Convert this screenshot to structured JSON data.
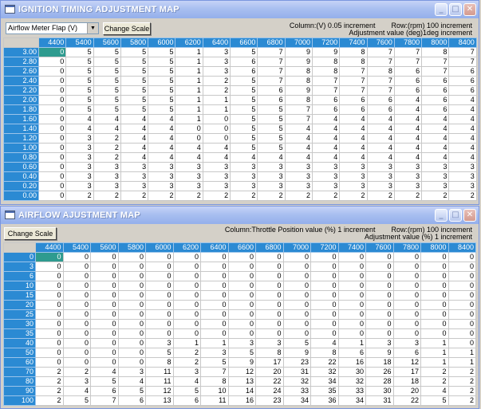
{
  "colors": {
    "header_bg": "#2b8ad3",
    "titlebar": "#a9bff0",
    "selected_cell": "#2e9b8f"
  },
  "window1": {
    "title": "IGNITION TIMING ADJUSTMENT MAP",
    "dropdown_value": "Airflow Meter Flap (V)",
    "change_scale": "Change Scale",
    "info_line1": "Column:(V) 0.05 increment        Row:(rpm) 100 increment",
    "info_line2": "Adjustment value (deg)1deg increment",
    "columns": [
      "4400",
      "5400",
      "5600",
      "5800",
      "6000",
      "6200",
      "6400",
      "6600",
      "6800",
      "7000",
      "7200",
      "7400",
      "7600",
      "7800",
      "8000",
      "8400"
    ],
    "rows": [
      {
        "label": "3.00",
        "cells": [
          "0",
          "5",
          "5",
          "5",
          "5",
          "1",
          "3",
          "5",
          "7",
          "9",
          "9",
          "8",
          "7",
          "7",
          "8",
          "7"
        ]
      },
      {
        "label": "2.80",
        "cells": [
          "0",
          "5",
          "5",
          "5",
          "5",
          "1",
          "3",
          "6",
          "7",
          "9",
          "8",
          "8",
          "7",
          "7",
          "7",
          "7"
        ]
      },
      {
        "label": "2.60",
        "cells": [
          "0",
          "5",
          "5",
          "5",
          "5",
          "1",
          "3",
          "6",
          "7",
          "8",
          "8",
          "7",
          "8",
          "6",
          "7",
          "6"
        ]
      },
      {
        "label": "2.40",
        "cells": [
          "0",
          "5",
          "5",
          "5",
          "5",
          "1",
          "2",
          "5",
          "7",
          "8",
          "7",
          "7",
          "7",
          "6",
          "6",
          "6"
        ]
      },
      {
        "label": "2.20",
        "cells": [
          "0",
          "5",
          "5",
          "5",
          "5",
          "1",
          "2",
          "5",
          "6",
          "9",
          "7",
          "7",
          "7",
          "6",
          "6",
          "6"
        ]
      },
      {
        "label": "2.00",
        "cells": [
          "0",
          "5",
          "5",
          "5",
          "5",
          "1",
          "1",
          "5",
          "6",
          "8",
          "6",
          "6",
          "6",
          "4",
          "6",
          "4"
        ]
      },
      {
        "label": "1.80",
        "cells": [
          "0",
          "5",
          "5",
          "5",
          "5",
          "1",
          "1",
          "5",
          "5",
          "7",
          "6",
          "6",
          "6",
          "4",
          "6",
          "4"
        ]
      },
      {
        "label": "1.60",
        "cells": [
          "0",
          "4",
          "4",
          "4",
          "4",
          "1",
          "0",
          "5",
          "5",
          "7",
          "4",
          "4",
          "4",
          "4",
          "4",
          "4"
        ]
      },
      {
        "label": "1.40",
        "cells": [
          "0",
          "4",
          "4",
          "4",
          "4",
          "0",
          "0",
          "5",
          "5",
          "4",
          "4",
          "4",
          "4",
          "4",
          "4",
          "4"
        ]
      },
      {
        "label": "1.20",
        "cells": [
          "0",
          "3",
          "2",
          "4",
          "4",
          "0",
          "0",
          "5",
          "5",
          "4",
          "4",
          "4",
          "4",
          "4",
          "4",
          "4"
        ]
      },
      {
        "label": "1.00",
        "cells": [
          "0",
          "3",
          "2",
          "4",
          "4",
          "4",
          "4",
          "5",
          "5",
          "4",
          "4",
          "4",
          "4",
          "4",
          "4",
          "4"
        ]
      },
      {
        "label": "0.80",
        "cells": [
          "0",
          "3",
          "2",
          "4",
          "4",
          "4",
          "4",
          "4",
          "4",
          "4",
          "4",
          "4",
          "4",
          "4",
          "4",
          "4"
        ]
      },
      {
        "label": "0.60",
        "cells": [
          "0",
          "3",
          "3",
          "3",
          "3",
          "3",
          "3",
          "3",
          "3",
          "3",
          "3",
          "3",
          "3",
          "3",
          "3",
          "3"
        ]
      },
      {
        "label": "0.40",
        "cells": [
          "0",
          "3",
          "3",
          "3",
          "3",
          "3",
          "3",
          "3",
          "3",
          "3",
          "3",
          "3",
          "3",
          "3",
          "3",
          "3"
        ]
      },
      {
        "label": "0.20",
        "cells": [
          "0",
          "3",
          "3",
          "3",
          "3",
          "3",
          "3",
          "3",
          "3",
          "3",
          "3",
          "3",
          "3",
          "3",
          "3",
          "3"
        ]
      },
      {
        "label": "0.00",
        "cells": [
          "0",
          "2",
          "2",
          "2",
          "2",
          "2",
          "2",
          "2",
          "2",
          "2",
          "2",
          "2",
          "2",
          "2",
          "2",
          "2"
        ]
      }
    ]
  },
  "window2": {
    "title": "AIRFLOW AJUSTMENT MAP",
    "change_scale": "Change Scale",
    "info_line1": "Column:Throttle Position value (%) 1 increment        Row:(rpm) 100 increment",
    "info_line2": "Adjustment value (%) 1 increment",
    "columns": [
      "4400",
      "5400",
      "5600",
      "5800",
      "6000",
      "6200",
      "6400",
      "6600",
      "6800",
      "7000",
      "7200",
      "7400",
      "7600",
      "7800",
      "8000",
      "8400"
    ],
    "rows": [
      {
        "label": "0",
        "cells": [
          "0",
          "0",
          "0",
          "0",
          "0",
          "0",
          "0",
          "0",
          "0",
          "0",
          "0",
          "0",
          "0",
          "0",
          "0",
          "0"
        ]
      },
      {
        "label": "3",
        "cells": [
          "0",
          "0",
          "0",
          "0",
          "0",
          "0",
          "0",
          "0",
          "0",
          "0",
          "0",
          "0",
          "0",
          "0",
          "0",
          "0"
        ]
      },
      {
        "label": "6",
        "cells": [
          "0",
          "0",
          "0",
          "0",
          "0",
          "0",
          "0",
          "0",
          "0",
          "0",
          "0",
          "0",
          "0",
          "0",
          "0",
          "0"
        ]
      },
      {
        "label": "10",
        "cells": [
          "0",
          "0",
          "0",
          "0",
          "0",
          "0",
          "0",
          "0",
          "0",
          "0",
          "0",
          "0",
          "0",
          "0",
          "0",
          "0"
        ]
      },
      {
        "label": "15",
        "cells": [
          "0",
          "0",
          "0",
          "0",
          "0",
          "0",
          "0",
          "0",
          "0",
          "0",
          "0",
          "0",
          "0",
          "0",
          "0",
          "0"
        ]
      },
      {
        "label": "20",
        "cells": [
          "0",
          "0",
          "0",
          "0",
          "0",
          "0",
          "0",
          "0",
          "0",
          "0",
          "0",
          "0",
          "0",
          "0",
          "0",
          "0"
        ]
      },
      {
        "label": "25",
        "cells": [
          "0",
          "0",
          "0",
          "0",
          "0",
          "0",
          "0",
          "0",
          "0",
          "0",
          "0",
          "0",
          "0",
          "0",
          "0",
          "0"
        ]
      },
      {
        "label": "30",
        "cells": [
          "0",
          "0",
          "0",
          "0",
          "0",
          "0",
          "0",
          "0",
          "0",
          "0",
          "0",
          "0",
          "0",
          "0",
          "0",
          "0"
        ]
      },
      {
        "label": "35",
        "cells": [
          "0",
          "0",
          "0",
          "0",
          "0",
          "0",
          "0",
          "0",
          "0",
          "0",
          "0",
          "0",
          "0",
          "0",
          "0",
          "0"
        ]
      },
      {
        "label": "40",
        "cells": [
          "0",
          "0",
          "0",
          "0",
          "3",
          "1",
          "1",
          "3",
          "3",
          "5",
          "4",
          "1",
          "3",
          "3",
          "1",
          "0"
        ]
      },
      {
        "label": "50",
        "cells": [
          "0",
          "0",
          "0",
          "0",
          "5",
          "2",
          "3",
          "5",
          "8",
          "9",
          "8",
          "6",
          "9",
          "6",
          "1",
          "1"
        ]
      },
      {
        "label": "60",
        "cells": [
          "0",
          "0",
          "0",
          "0",
          "8",
          "2",
          "5",
          "9",
          "17",
          "23",
          "22",
          "16",
          "18",
          "12",
          "1",
          "1"
        ]
      },
      {
        "label": "70",
        "cells": [
          "2",
          "2",
          "4",
          "3",
          "11",
          "3",
          "7",
          "12",
          "20",
          "31",
          "32",
          "30",
          "26",
          "17",
          "2",
          "2"
        ]
      },
      {
        "label": "80",
        "cells": [
          "2",
          "3",
          "5",
          "4",
          "11",
          "4",
          "8",
          "13",
          "22",
          "32",
          "34",
          "32",
          "28",
          "18",
          "2",
          "2"
        ]
      },
      {
        "label": "90",
        "cells": [
          "2",
          "4",
          "6",
          "5",
          "12",
          "5",
          "10",
          "14",
          "24",
          "33",
          "35",
          "33",
          "30",
          "20",
          "4",
          "2"
        ]
      },
      {
        "label": "100",
        "cells": [
          "2",
          "5",
          "7",
          "6",
          "13",
          "6",
          "11",
          "16",
          "23",
          "34",
          "36",
          "34",
          "31",
          "22",
          "5",
          "2"
        ]
      }
    ]
  },
  "icons": {
    "title_icon": "window-icon",
    "minimize": "minimize-icon",
    "maximize": "maximize-icon",
    "close": "close-icon"
  }
}
